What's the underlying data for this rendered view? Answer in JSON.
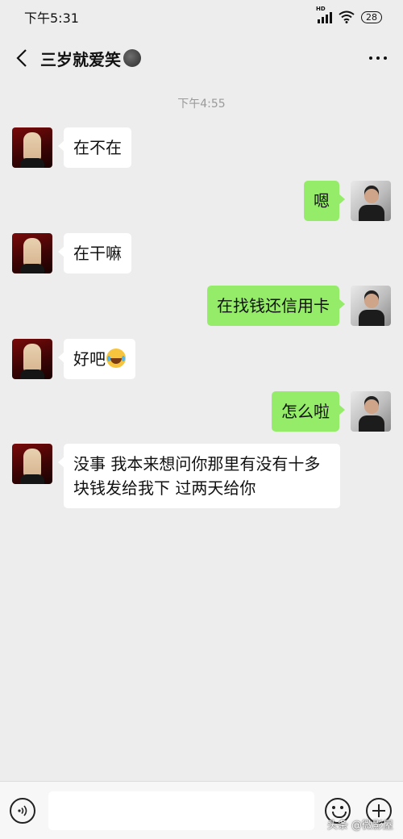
{
  "status_bar": {
    "time": "下午5:31",
    "network": "HD",
    "battery": "28"
  },
  "header": {
    "title": "三岁就爱笑"
  },
  "chat": {
    "timestamp": "下午4:55",
    "messages": [
      {
        "side": "left",
        "text": "在不在"
      },
      {
        "side": "right",
        "text": "嗯"
      },
      {
        "side": "left",
        "text": "在干嘛"
      },
      {
        "side": "right",
        "text": "在找钱还信用卡"
      },
      {
        "side": "left",
        "text": "好吧"
      },
      {
        "side": "right",
        "text": "怎么啦"
      },
      {
        "side": "left",
        "text_line1": "没事 我本来想问你那里有没有十多",
        "text_line2": "块钱发给我下 过两天给你"
      }
    ]
  },
  "input": {
    "value": ""
  },
  "watermark": "头条 @微影屋",
  "colors": {
    "background": "#ededed",
    "sent_bubble": "#95ec69",
    "received_bubble": "#ffffff"
  }
}
